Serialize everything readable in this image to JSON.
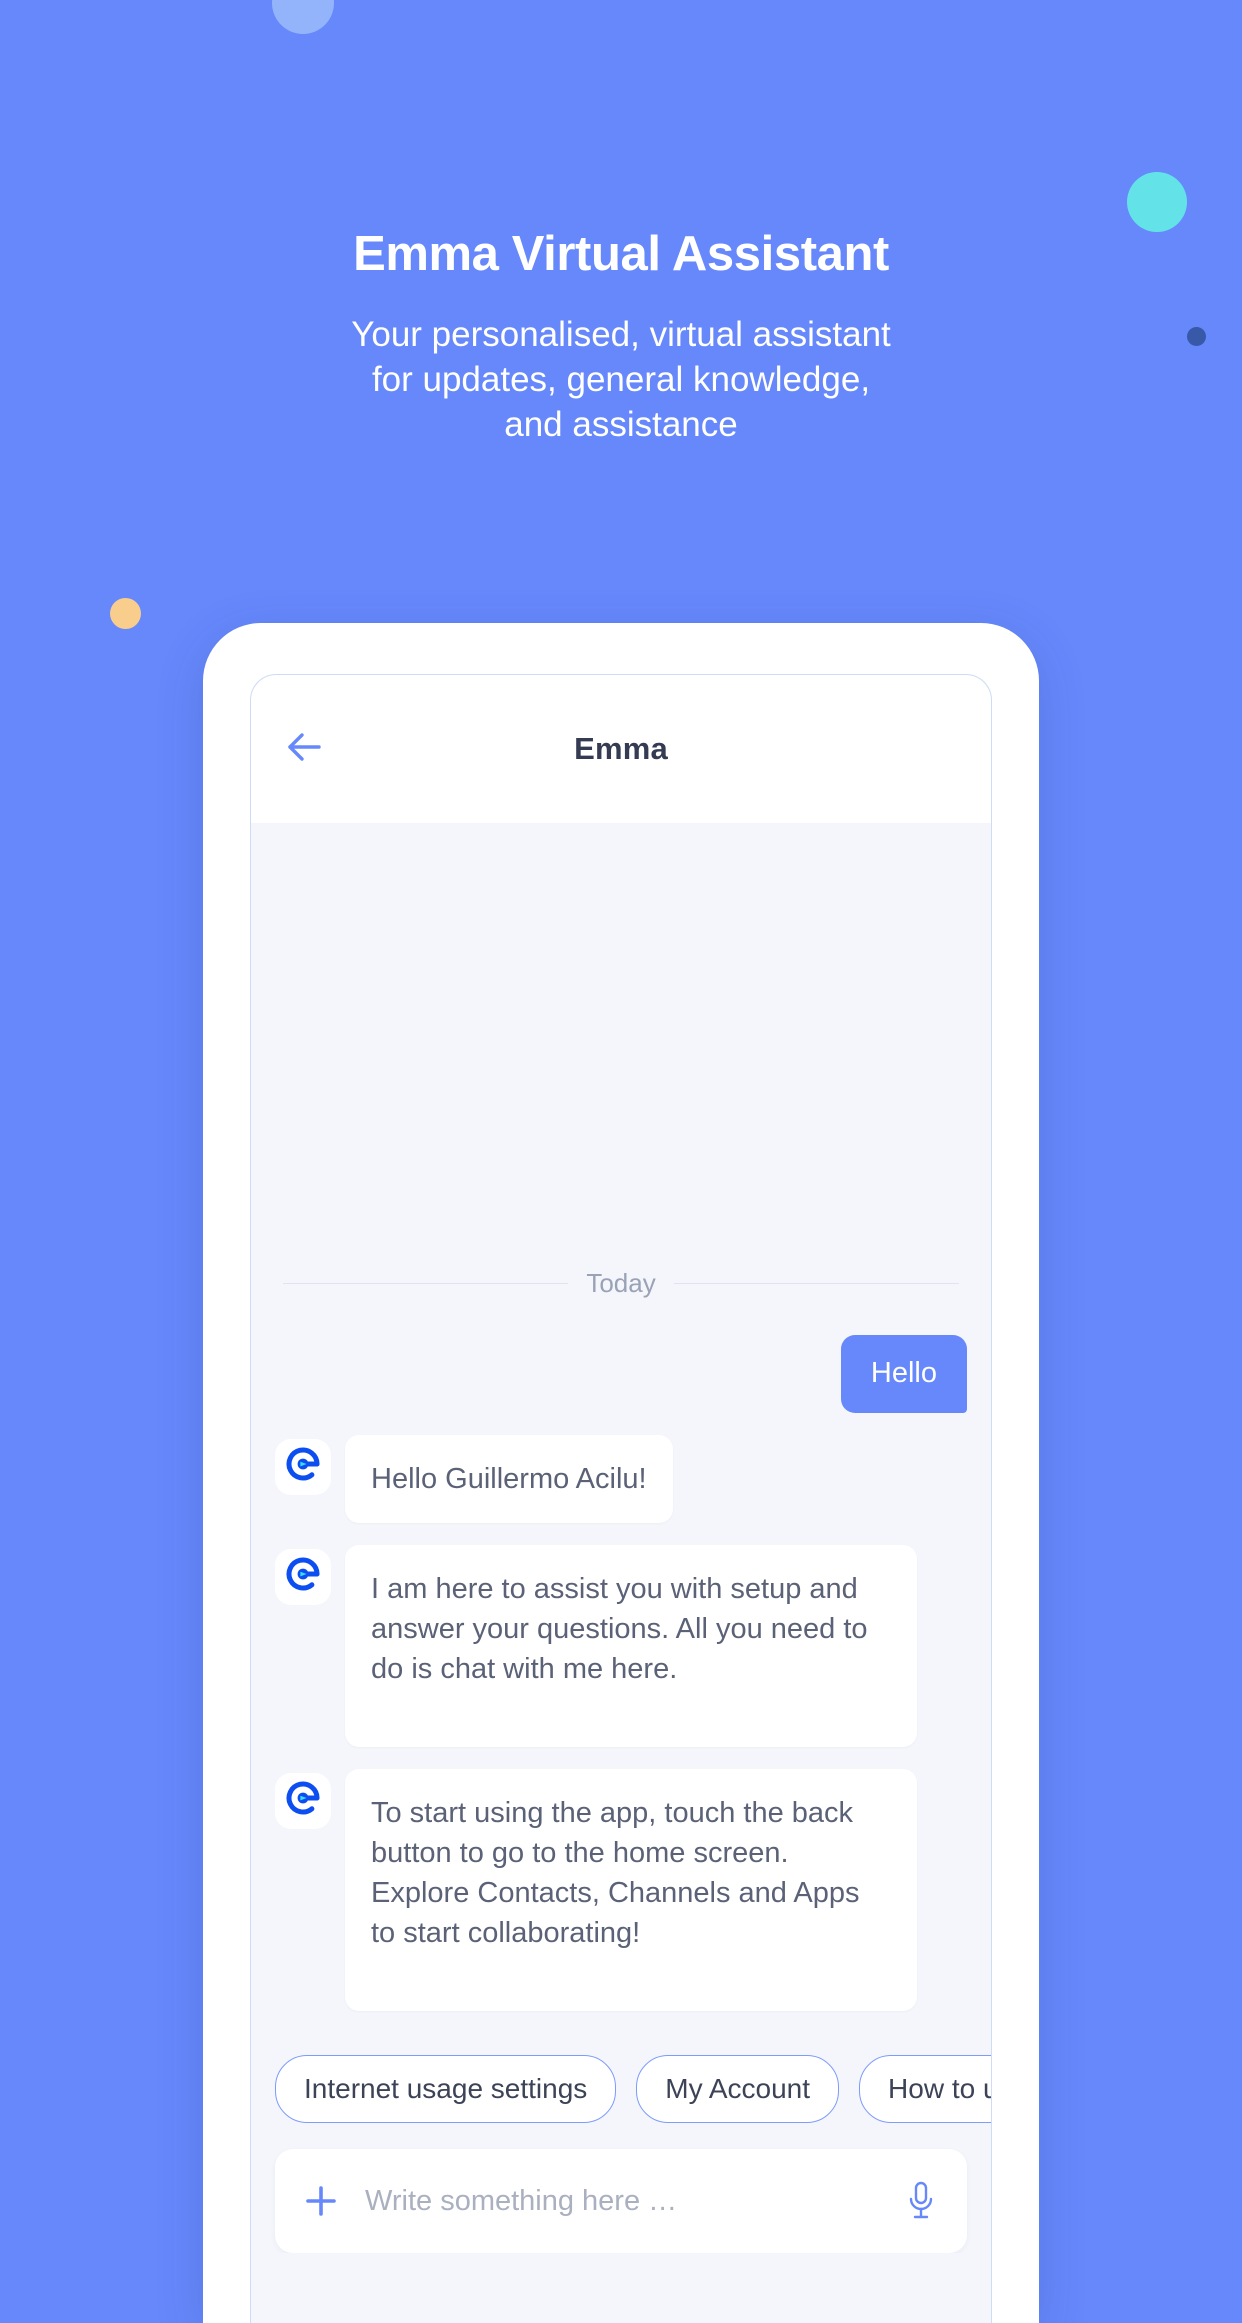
{
  "hero": {
    "title": "Emma Virtual Assistant",
    "subtitle": "Your personalised, virtual assistant\nfor updates, general knowledge,\nand assistance"
  },
  "colors": {
    "background": "#6688fb",
    "accent": "#6688fb",
    "screen": "#f4f6fb",
    "bubble_in": "#ffffff",
    "bubble_out": "#6688fb",
    "text_primary": "#353b52",
    "text_body": "#5b6277",
    "chip_border": "#7d9cfb",
    "logo_blue": "#0d4ef0",
    "deco_light_blue": "#93b4fb",
    "deco_cyan": "#63e3e8",
    "deco_navy": "#3858a8",
    "deco_orange": "#f9cd8c"
  },
  "decorations": [
    {
      "name": "circle-light-blue",
      "color": "#93b4fb"
    },
    {
      "name": "circle-cyan",
      "color": "#63e3e8"
    },
    {
      "name": "dot-navy",
      "color": "#3858a8"
    },
    {
      "name": "circle-orange",
      "color": "#f9cd8c"
    }
  ],
  "appbar": {
    "back_icon": "arrow-left-icon",
    "title": "Emma"
  },
  "chat": {
    "day_label": "Today",
    "avatar_icon": "emma-logo-icon",
    "messages": [
      {
        "id": "msg-1",
        "direction": "outgoing",
        "text": "Hello"
      },
      {
        "id": "msg-2",
        "direction": "incoming",
        "text": "Hello Guillermo Acilu!"
      },
      {
        "id": "msg-3",
        "direction": "incoming",
        "text": "I am here to assist you with setup and answer your questions. All you need to do is chat with me here."
      },
      {
        "id": "msg-4",
        "direction": "incoming",
        "text": "To start using the app, touch the back button to go to the home screen. Explore Contacts, Channels and Apps to start collaborating!"
      }
    ]
  },
  "quick_replies": [
    {
      "label": "Internet usage settings"
    },
    {
      "label": "My Account"
    },
    {
      "label": "How to use"
    }
  ],
  "composer": {
    "add_icon": "plus-icon",
    "placeholder": "Write something here …",
    "value": "",
    "mic_icon": "microphone-icon"
  }
}
